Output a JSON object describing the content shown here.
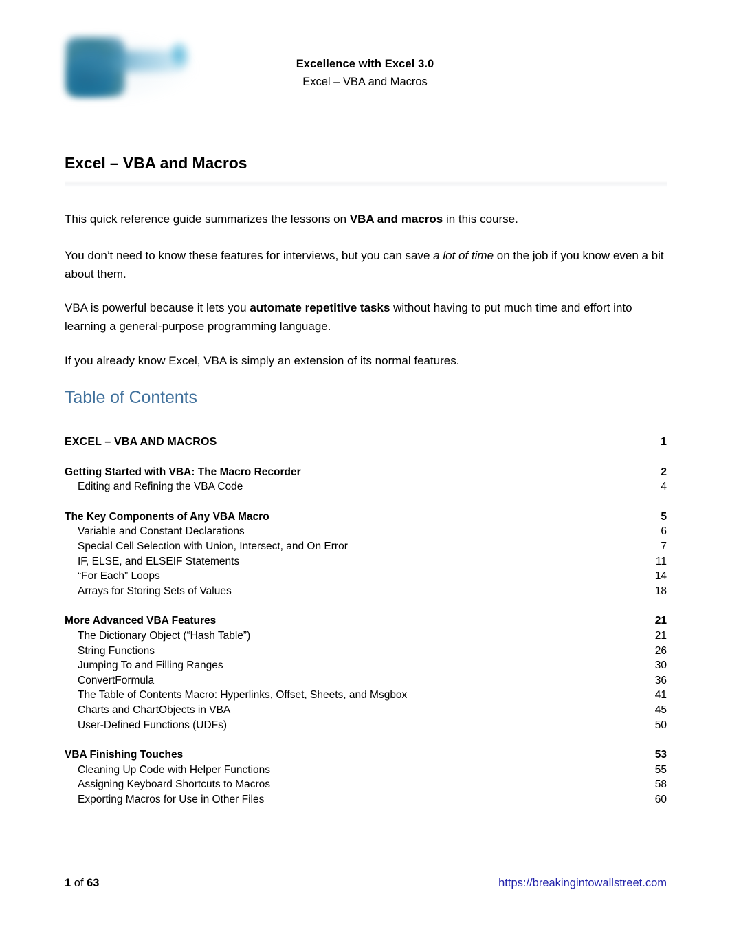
{
  "header": {
    "logo_alt": "breaking-into-wall-street-logo",
    "title": "Excellence with Excel 3.0",
    "subtitle": "Excel – VBA and Macros"
  },
  "document": {
    "h1": "Excel – VBA and Macros",
    "paragraphs": {
      "p1_pre": "This quick reference guide summarizes the lessons on ",
      "p1_bold": "VBA and macros",
      "p1_post": " in this course.",
      "p2_pre": "You don’t need to know these features for interviews, but you can save ",
      "p2_italic": "a lot of time",
      "p2_post": " on the job if you know even a bit about them.",
      "p3_pre": "VBA is powerful because it lets you ",
      "p3_bold": "automate repetitive tasks",
      "p3_post": " without having to put much time and effort into learning a general-purpose programming language.",
      "p4": "If you already know Excel, VBA is simply an extension of its normal features."
    }
  },
  "toc": {
    "heading": "Table of Contents",
    "entries": [
      {
        "level": 0,
        "label": "EXCEL – VBA AND MACROS",
        "page": "1",
        "gap_before": "none"
      },
      {
        "level": 1,
        "label": "Getting Started with VBA: The Macro Recorder",
        "page": "2",
        "gap_before": "large"
      },
      {
        "level": 2,
        "label": "Editing and Refining the VBA Code",
        "page": "4",
        "gap_before": "none"
      },
      {
        "level": 1,
        "label": "The Key Components of Any VBA Macro",
        "page": "5",
        "gap_before": "large"
      },
      {
        "level": 2,
        "label": "Variable and Constant Declarations",
        "page": "6",
        "gap_before": "none"
      },
      {
        "level": 2,
        "label": "Special Cell Selection with Union, Intersect, and On Error",
        "page": "7",
        "gap_before": "none"
      },
      {
        "level": 2,
        "label": "IF, ELSE, and ELSEIF Statements",
        "page": "11",
        "gap_before": "none"
      },
      {
        "level": 2,
        "label": "“For Each” Loops",
        "page": "14",
        "gap_before": "none"
      },
      {
        "level": 2,
        "label": "Arrays for Storing Sets of Values",
        "page": "18",
        "gap_before": "none"
      },
      {
        "level": 1,
        "label": "More Advanced VBA Features",
        "page": "21",
        "gap_before": "large"
      },
      {
        "level": 2,
        "label": "The Dictionary Object (“Hash Table”)",
        "page": "21",
        "gap_before": "none"
      },
      {
        "level": 2,
        "label": "String Functions",
        "page": "26",
        "gap_before": "none"
      },
      {
        "level": 2,
        "label": "Jumping To and Filling Ranges",
        "page": "30",
        "gap_before": "none"
      },
      {
        "level": 2,
        "label": "ConvertFormula",
        "page": "36",
        "gap_before": "none"
      },
      {
        "level": 2,
        "label": "The Table of Contents Macro: Hyperlinks, Offset, Sheets, and Msgbox",
        "page": "41",
        "gap_before": "none"
      },
      {
        "level": 2,
        "label": "Charts and ChartObjects in VBA",
        "page": "45",
        "gap_before": "none"
      },
      {
        "level": 2,
        "label": "User-Defined Functions (UDFs)",
        "page": "50",
        "gap_before": "none"
      },
      {
        "level": 1,
        "label": "VBA Finishing Touches",
        "page": "53",
        "gap_before": "large"
      },
      {
        "level": 2,
        "label": "Cleaning Up Code with Helper Functions",
        "page": "55",
        "gap_before": "none"
      },
      {
        "level": 2,
        "label": "Assigning Keyboard Shortcuts to Macros",
        "page": "58",
        "gap_before": "none"
      },
      {
        "level": 2,
        "label": "Exporting Macros for Use in Other Files",
        "page": "60",
        "gap_before": "none"
      }
    ]
  },
  "footer": {
    "page_current": "1",
    "page_of": " of ",
    "page_total": "63",
    "url": "https://breakingintowallstreet.com"
  },
  "colors": {
    "toc_heading": "#41719C",
    "link": "#2222AA",
    "text": "#000000",
    "rule": "#F4F5F6"
  }
}
